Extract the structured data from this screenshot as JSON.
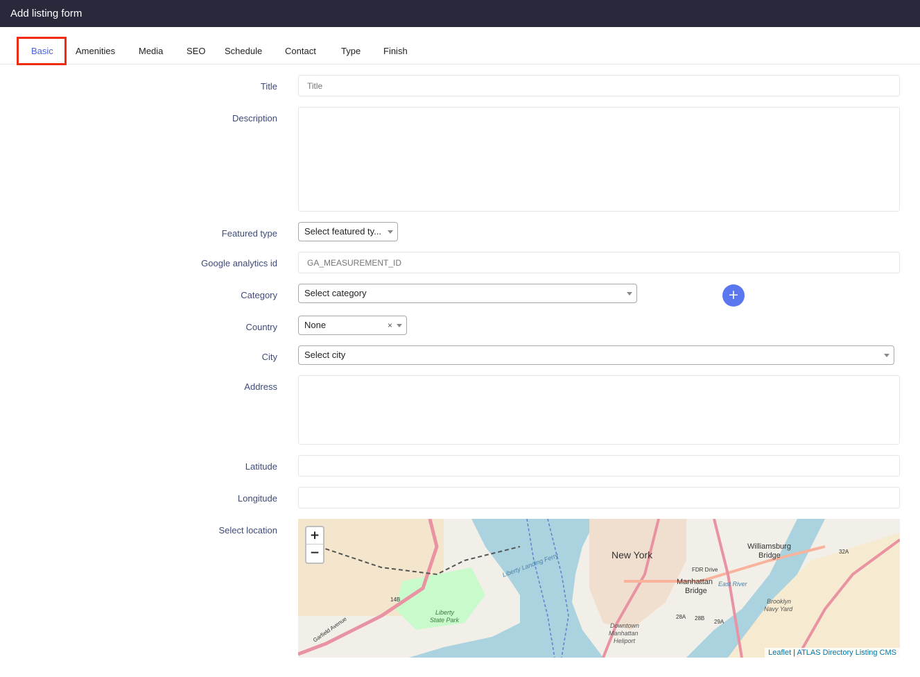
{
  "header": {
    "title": "Add listing form"
  },
  "tabs": [
    {
      "label": "Basic",
      "active": true
    },
    {
      "label": "Amenities"
    },
    {
      "label": "Media"
    },
    {
      "label": "SEO"
    },
    {
      "label": "Schedule"
    },
    {
      "label": "Contact"
    },
    {
      "label": "Type"
    },
    {
      "label": "Finish"
    }
  ],
  "form": {
    "title": {
      "label": "Title",
      "placeholder": "Title",
      "value": ""
    },
    "description": {
      "label": "Description",
      "value": ""
    },
    "featured_type": {
      "label": "Featured type",
      "selected": "Select featured ty..."
    },
    "analytics": {
      "label": "Google analytics id",
      "placeholder": "GA_MEASUREMENT_ID",
      "value": ""
    },
    "category": {
      "label": "Category",
      "selected": "Select category",
      "add_icon": "plus-icon"
    },
    "country": {
      "label": "Country",
      "selected": "None",
      "clear_glyph": "×"
    },
    "city": {
      "label": "City",
      "selected": "Select city"
    },
    "address": {
      "label": "Address",
      "value": ""
    },
    "latitude": {
      "label": "Latitude",
      "value": ""
    },
    "longitude": {
      "label": "Longitude",
      "value": ""
    },
    "location": {
      "label": "Select location"
    }
  },
  "map": {
    "zoom_in": "+",
    "zoom_out": "−",
    "attribution_link": "Leaflet",
    "attribution_separator": "|",
    "attribution_source": "ATLAS Directory Listing CMS",
    "labels": {
      "new_york": "New York",
      "williamsburg": "Williamsburg",
      "bridge": "Bridge",
      "manhattan": "Manhattan",
      "manhattan_bridge": "Bridge",
      "liberty": "Liberty",
      "state_park": "State Park",
      "brooklyn": "Brooklyn",
      "navy_yard": "Navy Yard",
      "downtown": "Downtown",
      "manhattan_heliport": "Manhattan",
      "heliport": "Heliport",
      "fdr_drive": "FDR Drive",
      "east_river": "East River",
      "liberty_ferry": "Liberty Landing Ferry",
      "garfield": "Garfield Avenue",
      "route_14b": "14B",
      "route_32a": "32A",
      "route_29a": "29A",
      "route_28b": "28B",
      "route_28a": "28A"
    }
  },
  "colors": {
    "header_bg": "#282a3c",
    "active_tab": "#4a63e0",
    "highlight": "#ee2a10",
    "label": "#3f4a78",
    "add_button": "#5b77f0",
    "water": "#aad3df",
    "park": "#c8facc"
  }
}
